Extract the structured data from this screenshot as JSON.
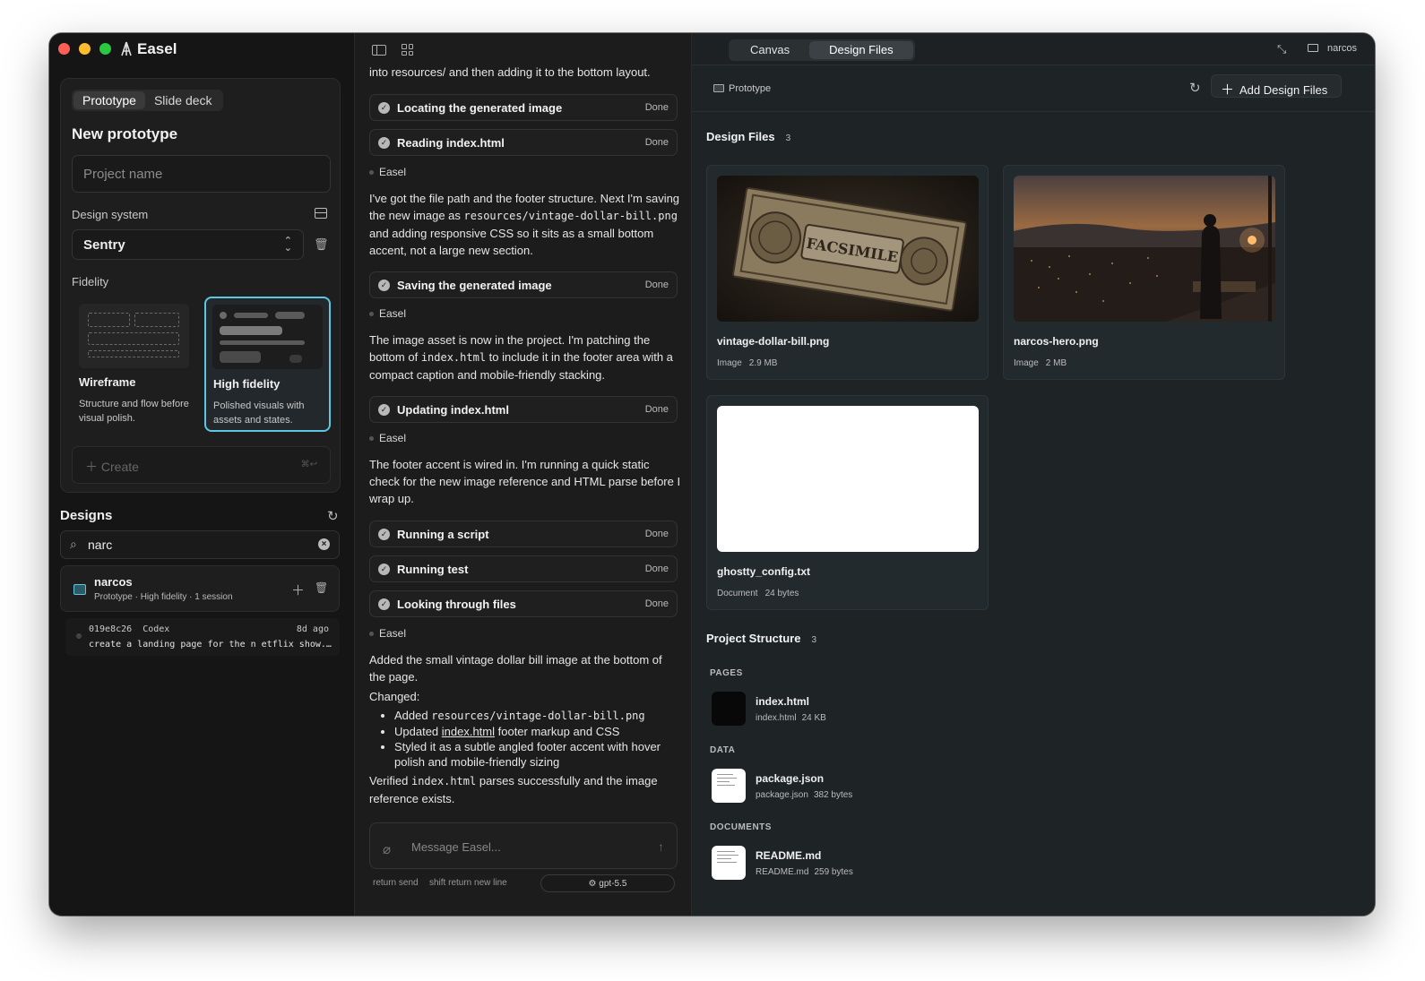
{
  "app": {
    "title": "Easel"
  },
  "left": {
    "mode_tabs": [
      "Prototype",
      "Slide deck"
    ],
    "active_mode": "Prototype",
    "card_title": "New prototype",
    "project_name_placeholder": "Project name",
    "design_system_label": "Design system",
    "design_system_value": "Sentry",
    "fidelity_label": "Fidelity",
    "fidelity": [
      {
        "name": "Wireframe",
        "desc": "Structure and flow before visual polish."
      },
      {
        "name": "High fidelity",
        "desc": "Polished visuals with assets and states."
      }
    ],
    "selected_fidelity": "High fidelity",
    "create_label": "Create",
    "create_shortcut": "⌘↩",
    "designs_title": "Designs",
    "search_value": "narc",
    "design_item": {
      "name": "narcos",
      "meta": "Prototype · High fidelity · 1 session"
    },
    "session": {
      "id": "019e8c26",
      "agent": "Codex",
      "ago": "8d ago",
      "text": "create a landing page for the n etflix show..."
    }
  },
  "center": {
    "intro": "into resources/ and then adding it to the bottom layout.",
    "steps": [
      {
        "title": "Locating the generated image",
        "status": "Done"
      },
      {
        "title": "Reading index.html",
        "status": "Done"
      },
      {
        "title": "Saving the generated image",
        "status": "Done"
      },
      {
        "title": "Updating index.html",
        "status": "Done"
      },
      {
        "title": "Running a script",
        "status": "Done"
      },
      {
        "title": "Running test",
        "status": "Done"
      },
      {
        "title": "Looking through files",
        "status": "Done"
      }
    ],
    "author": "Easel",
    "msg1_a": "I've got the file path and the footer structure. Next I'm saving the new image as ",
    "msg1_code": "resources/vintage-dollar-bill.png",
    "msg1_b": " and adding responsive CSS so it sits as a small bottom accent, not a large new section.",
    "msg2_a": "The image asset is now in the project. I'm patching the bottom of ",
    "msg2_code": "index.html",
    "msg2_b": " to include it in the footer area with a compact caption and mobile-friendly stacking.",
    "msg3": "The footer accent is wired in. I'm running a quick static check for the new image reference and HTML parse before I wrap up.",
    "final_intro": "Added the small vintage dollar bill image at the bottom of the page.",
    "changed_label": "Changed:",
    "bullet1_a": "Added ",
    "bullet1_code": "resources/vintage-dollar-bill.png",
    "bullet2_a": "Updated ",
    "bullet2_link": "index.html",
    "bullet2_b": " footer markup and CSS",
    "bullet3": "Styled it as a subtle angled footer accent with hover polish and mobile-friendly sizing",
    "verified_a": "Verified ",
    "verified_code": "index.html",
    "verified_b": " parses successfully and the image reference exists.",
    "message_placeholder": "Message Easel...",
    "hint_send": "return send",
    "hint_newline": "shift return new line",
    "model": "gpt-5.5"
  },
  "right": {
    "tabs": [
      "Canvas",
      "Design Files"
    ],
    "active_tab": "Design Files",
    "folder": "narcos",
    "breadcrumb": "Prototype",
    "add_button": "Add Design Files",
    "design_files_title": "Design Files",
    "design_files_count": "3",
    "files": [
      {
        "name": "vintage-dollar-bill.png",
        "kind": "Image",
        "size": "2.9 MB"
      },
      {
        "name": "narcos-hero.png",
        "kind": "Image",
        "size": "2 MB"
      },
      {
        "name": "ghostty_config.txt",
        "kind": "Document",
        "size": "24 bytes"
      }
    ],
    "facsimile_text": "FACSIMILE",
    "structure_title": "Project Structure",
    "structure_count": "3",
    "groups": [
      {
        "label": "PAGES",
        "item": {
          "name": "index.html",
          "file": "index.html",
          "size": "24 KB"
        }
      },
      {
        "label": "DATA",
        "item": {
          "name": "package.json",
          "file": "package.json",
          "size": "382 bytes"
        }
      },
      {
        "label": "DOCUMENTS",
        "item": {
          "name": "README.md",
          "file": "README.md",
          "size": "259 bytes"
        }
      }
    ]
  },
  "colors": {
    "accent": "#5cc7e0",
    "close": "#ff5f57",
    "minimize": "#febc2e",
    "zoom": "#28c840"
  }
}
